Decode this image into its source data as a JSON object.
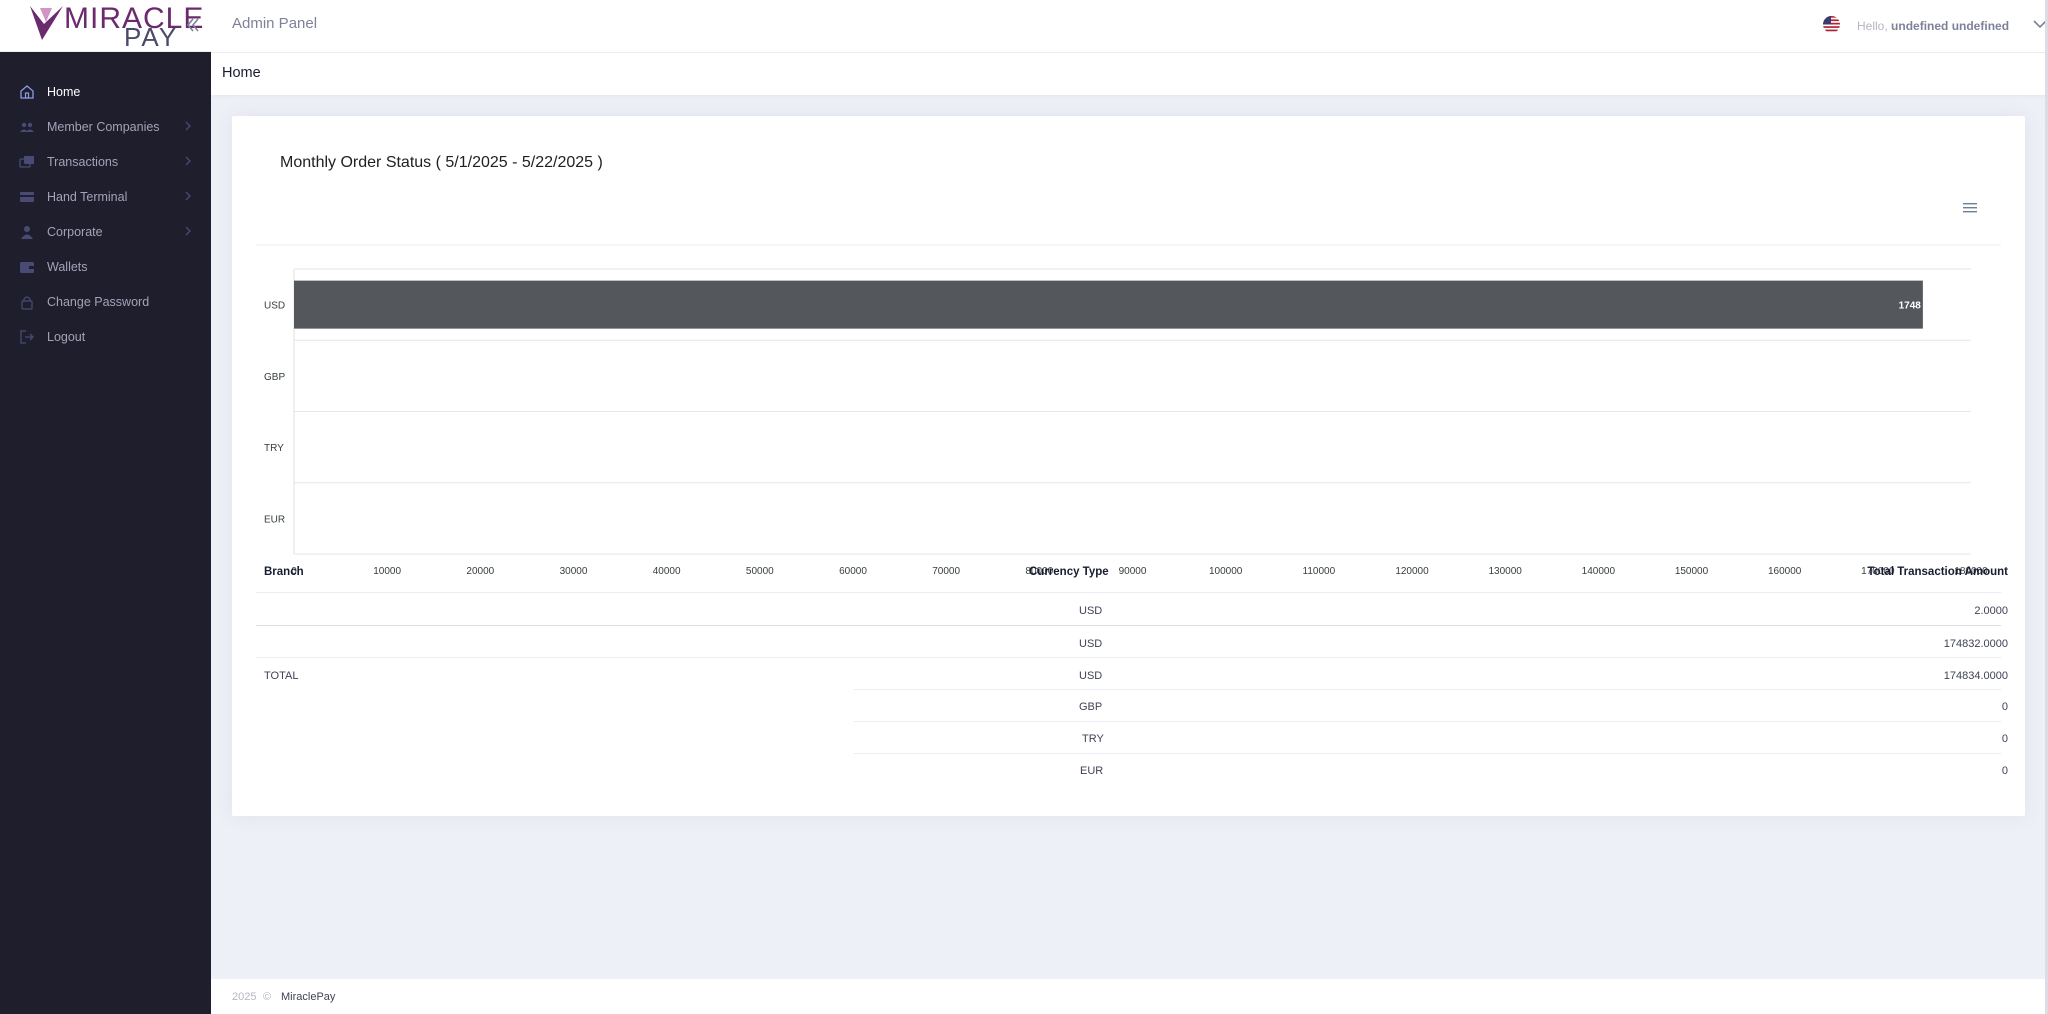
{
  "app": {
    "logo_line1": "MIRACLE",
    "logo_line2": "PAY",
    "header_title": "Admin Panel",
    "hello_prefix": "Hello,",
    "user_name": "undefined undefined",
    "page_title": "Home",
    "accent_color": "#6a2a6d"
  },
  "sidebar": {
    "items": [
      {
        "label": "Home",
        "icon": "home-icon",
        "active": true,
        "chevron": false
      },
      {
        "label": "Member Companies",
        "icon": "users-icon",
        "active": false,
        "chevron": true
      },
      {
        "label": "Transactions",
        "icon": "cards-icon",
        "active": false,
        "chevron": true
      },
      {
        "label": "Hand Terminal",
        "icon": "terminal-icon",
        "active": false,
        "chevron": true
      },
      {
        "label": "Corporate",
        "icon": "user-icon",
        "active": false,
        "chevron": true
      },
      {
        "label": "Wallets",
        "icon": "wallet-icon",
        "active": false,
        "chevron": false
      },
      {
        "label": "Change Password",
        "icon": "lock-icon",
        "active": false,
        "chevron": false
      },
      {
        "label": "Logout",
        "icon": "logout-icon",
        "active": false,
        "chevron": false
      }
    ]
  },
  "card": {
    "title": "Monthly Order Status ( 5/1/2025 - 5/22/2025 )"
  },
  "chart_data": {
    "type": "bar",
    "orientation": "horizontal",
    "categories": [
      "USD",
      "GBP",
      "TRY",
      "EUR"
    ],
    "values": [
      174834,
      0,
      0,
      0
    ],
    "data_labels": [
      "1748",
      "",
      "",
      ""
    ],
    "xlim": [
      0,
      180000
    ],
    "xticks": [
      0,
      10000,
      20000,
      30000,
      40000,
      50000,
      60000,
      70000,
      80000,
      90000,
      100000,
      110000,
      120000,
      130000,
      140000,
      150000,
      160000,
      170000,
      180000
    ],
    "bar_color": "#54585c",
    "grid": true
  },
  "table": {
    "headers": {
      "branch": "Branch",
      "currency": "Currency Type",
      "amount": "Total Transaction Amount"
    },
    "rows": [
      {
        "branch": "",
        "currency": "USD",
        "amount": "2.0000"
      },
      {
        "branch": "",
        "currency": "USD",
        "amount": "174832.0000"
      }
    ],
    "total_label": "TOTAL",
    "totals": [
      {
        "currency": "USD",
        "amount": "174834.0000"
      },
      {
        "currency": "GBP",
        "amount": "0"
      },
      {
        "currency": "TRY",
        "amount": "0"
      },
      {
        "currency": "EUR",
        "amount": "0"
      }
    ]
  },
  "footer": {
    "year": "2025",
    "copyright_symbol": "©",
    "brand": "MiraclePay"
  }
}
